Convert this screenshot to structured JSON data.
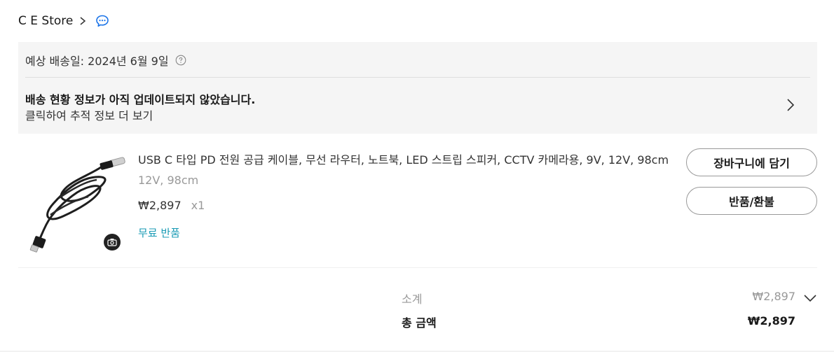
{
  "store": {
    "name": "C E Store",
    "chevron_icon": "chevron-right-icon",
    "chat_icon": "chat-bubble-icon"
  },
  "shipping": {
    "eta": "예상 배송일: 2024년 6월 9일",
    "help_icon": "question-circle-icon",
    "status_title": "배송 현황 정보가 아직 업데이트되지 않았습니다.",
    "status_link": "클릭하여 추적 정보 더 보기",
    "chevron_icon": "chevron-right-icon"
  },
  "item": {
    "title": "USB C 타입 PD 전원 공급 케이블, 무선 라우터, 노트북, LED 스트립 스피커, CCTV 카메라용, 9V, 12V, 98cm",
    "variant": "12V, 98cm",
    "price": "₩2,897",
    "quantity": "x1",
    "free_return": "무료 반품",
    "image_icon": "usb-cable-product-image",
    "camera_icon": "camera-icon"
  },
  "actions": {
    "add_to_cart": "장바구니에 담기",
    "return_refund": "반품/환불"
  },
  "summary": {
    "subtotal_label": "소계",
    "subtotal_value": "₩2,897",
    "total_label": "총 금액",
    "total_value": "₩2,897",
    "expand_icon": "chevron-down-icon"
  },
  "colors": {
    "accent_link": "#1a9bb5",
    "chat_icon": "#1a73e8",
    "panel_bg": "#f5f5f5"
  }
}
